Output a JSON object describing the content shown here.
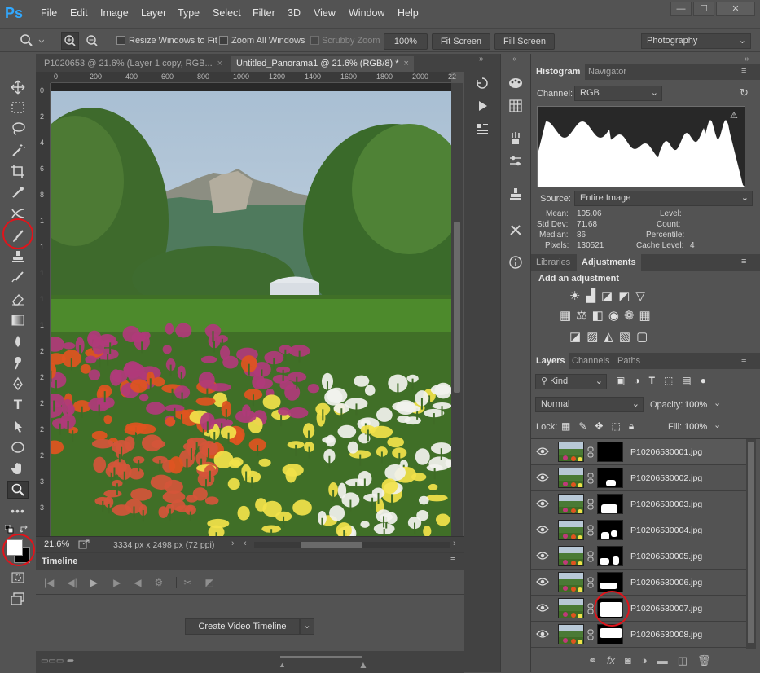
{
  "app": {
    "logo": "Ps"
  },
  "menu": [
    "File",
    "Edit",
    "Image",
    "Layer",
    "Type",
    "Select",
    "Filter",
    "3D",
    "View",
    "Window",
    "Help"
  ],
  "window_controls": {
    "minimize": "—",
    "restore": "☐",
    "close": "✕"
  },
  "options_bar": {
    "resize_windows": "Resize Windows to Fit",
    "zoom_all": "Zoom All Windows",
    "scrubby": "Scrubby Zoom",
    "zoom_value": "100%",
    "fit_screen": "Fit Screen",
    "fill_screen": "Fill Screen",
    "workspace": "Photography"
  },
  "doc_tabs": [
    {
      "label": "P1020653 @ 21.6% (Layer 1 copy, RGB...",
      "active": false
    },
    {
      "label": "Untitled_Panorama1 @ 21.6% (RGB/8) *",
      "active": true
    }
  ],
  "ruler": {
    "h_ticks": [
      "0",
      "200",
      "400",
      "600",
      "800",
      "1000",
      "1200",
      "1400",
      "1600",
      "1800",
      "2000",
      "22"
    ],
    "v_ticks": [
      "0",
      "2",
      "4",
      "6",
      "8",
      "1",
      "1",
      "1",
      "1",
      "1",
      "2",
      "2",
      "2",
      "2",
      "2",
      "3",
      "3"
    ]
  },
  "status": {
    "zoom": "21.6%",
    "doc_size": "3334 px x 2498 px (72 ppi)"
  },
  "timeline": {
    "title": "Timeline",
    "create_button": "Create Video Timeline"
  },
  "histogram": {
    "tabs": [
      "Histogram",
      "Navigator"
    ],
    "channel_label": "Channel:",
    "channel_value": "RGB",
    "source_label": "Source:",
    "source_value": "Entire Image",
    "stats_left": [
      {
        "label": "Mean:",
        "value": "105.06"
      },
      {
        "label": "Std Dev:",
        "value": "71.68"
      },
      {
        "label": "Median:",
        "value": "86"
      },
      {
        "label": "Pixels:",
        "value": "130521"
      }
    ],
    "stats_right": [
      {
        "label": "Level:",
        "value": ""
      },
      {
        "label": "Count:",
        "value": ""
      },
      {
        "label": "Percentile:",
        "value": ""
      },
      {
        "label": "Cache Level:",
        "value": "4"
      }
    ]
  },
  "adjustments": {
    "tabs": [
      "Libraries",
      "Adjustments"
    ],
    "heading": "Add an adjustment"
  },
  "layers": {
    "tabs": [
      "Layers",
      "Channels",
      "Paths"
    ],
    "kind": "Kind",
    "blend_mode": "Normal",
    "opacity_label": "Opacity:",
    "opacity_value": "100%",
    "lock_label": "Lock:",
    "fill_label": "Fill:",
    "fill_value": "100%",
    "items": [
      {
        "name": "P10206530001.jpg"
      },
      {
        "name": "P10206530002.jpg"
      },
      {
        "name": "P10206530003.jpg"
      },
      {
        "name": "P10206530004.jpg"
      },
      {
        "name": "P10206530005.jpg"
      },
      {
        "name": "P10206530006.jpg"
      },
      {
        "name": "P10206530007.jpg"
      },
      {
        "name": "P10206530008.jpg"
      }
    ]
  }
}
